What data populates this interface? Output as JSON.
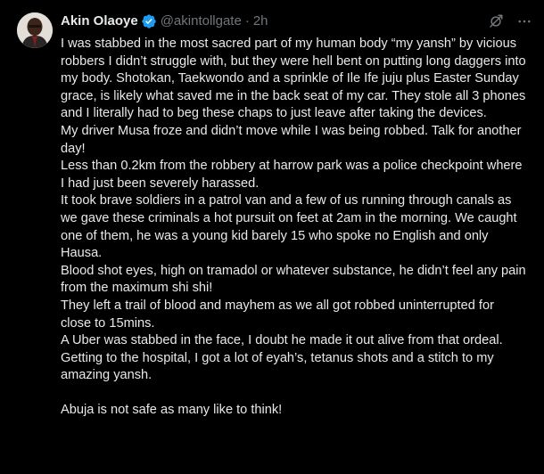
{
  "author": {
    "name": "Akin Olaoye",
    "handle": "@akintollgate",
    "separator": "·",
    "time": "2h"
  },
  "icons": {
    "verified": "verified-badge-icon",
    "grok": "grok-icon",
    "more": "more-icon"
  },
  "colors": {
    "background": "#000000",
    "text": "#e7e9ea",
    "secondary": "#71767b",
    "verified": "#1d9bf0"
  },
  "paragraphs": [
    "I was stabbed in the most sacred part of my human body “my yansh” by vicious robbers I didn’t struggle with, but they were hell bent on putting long daggers into my body. Shotokan, Taekwondo and a sprinkle of Ile Ife juju plus Easter Sunday grace, is likely what saved me in the back seat of my car. They stole all 3 phones and I literally had to beg these chaps to just leave after taking the devices.",
    "My driver Musa froze and didn’t move while I was being robbed. Talk for another day!",
    "Less than 0.2km from the robbery at harrow park was a police checkpoint where I had just been severely harassed.",
    "It took brave soldiers in a patrol van  and a few of us running through canals as we gave these criminals a hot pursuit on feet at 2am in the morning. We caught one of them, he was a young kid barely 15 who spoke no English and only Hausa.",
    "Blood shot eyes, high on tramadol or whatever substance, he didn’t feel any pain from the maximum shi shi!",
    "They left a trail of blood and mayhem as we all got robbed uninterrupted for close to 15mins.",
    "A Uber was stabbed in the face, I doubt he made it out alive from that ordeal.",
    "Getting to the hospital, I got a lot of eyah’s, tetanus shots and a stitch to my amazing yansh.",
    "Abuja is not safe as many like to think!"
  ]
}
